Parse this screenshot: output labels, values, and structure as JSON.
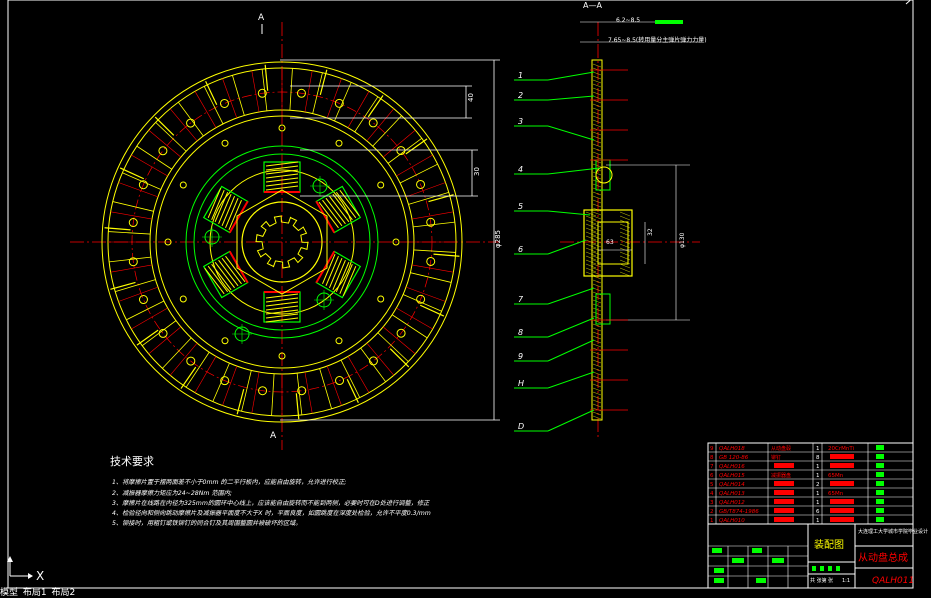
{
  "drawing": {
    "section_marks": {
      "top_left": "A",
      "top_center": "A—A",
      "letter": "A"
    },
    "dimensions": {
      "outer_dia": "φ285",
      "hub_dia": "φ130",
      "dim_40": "40",
      "dim_30": "30",
      "dim_12": "12",
      "dim_63": "63",
      "dim_32": "32",
      "top_small": "6.2~8.5",
      "top_note": "7.65~8.5(转用量分主弹片弹力力量)"
    },
    "leaders": [
      "1",
      "2",
      "3",
      "4",
      "5",
      "6",
      "7",
      "8",
      "9",
      "H",
      "D"
    ]
  },
  "tech": {
    "title": "技术要求",
    "lines": [
      "1、将摩擦片置于摆两面差不小于0mm  的二平行板内，应能自由旋转，允许进行校正;",
      "2、减振器摩擦力矩应为24~28Nm  范围内;",
      "3、摩擦片在线路在内径为325mm的圆环中心线上，应该能自由旋转而不能到两侧，必要时可在D处进行调整，修正",
      "4、检验径向和侧向跳动摩擦片及减振器平面度不大于X   时，平面良度，如圆跳度在深度处检验，允许不平度0.3/mm",
      "5、铆接时，用粗钉或铁铆钉的同合钉及其周围整圆并被破坏的区域。"
    ]
  },
  "bom": {
    "rows": [
      {
        "code": "QALH018",
        "name": "从动盘毂",
        "qty": "1",
        "mat": "20CrMnTi"
      },
      {
        "code": "GB 120-86",
        "name": "铆钉",
        "qty": "8",
        "mat": ""
      },
      {
        "code": "QALH016",
        "name": "",
        "qty": "1",
        "mat": ""
      },
      {
        "code": "QALH015",
        "name": "减振器盘",
        "qty": "1",
        "mat": "65Mn"
      },
      {
        "code": "QALH014",
        "name": "",
        "qty": "2",
        "mat": ""
      },
      {
        "code": "QALH013",
        "name": "",
        "qty": "1",
        "mat": "65Mn"
      },
      {
        "code": "QALH012",
        "name": "",
        "qty": "1",
        "mat": ""
      },
      {
        "code": "GB/T874-1986",
        "name": "",
        "qty": "6",
        "mat": ""
      },
      {
        "code": "QALH010",
        "name": "",
        "qty": "1",
        "mat": ""
      }
    ],
    "institution": "大连理工大学城市学院毕业设计",
    "drawing_type": "装配图",
    "product_name": "从动盘总成",
    "part_number": "QALH011",
    "sheet_info": "共 张第 张",
    "scale": "1:1"
  },
  "ui": {
    "ucs_label": "X",
    "tabs": [
      "模型",
      "布局1",
      "布局2"
    ]
  },
  "colors": {
    "bg": "#000000",
    "yellow": "#ffff00",
    "white": "#ffffff",
    "red": "#ff0000",
    "green": "#00ff00",
    "cyan": "#00ffff",
    "magenta": "#ff00ff"
  }
}
